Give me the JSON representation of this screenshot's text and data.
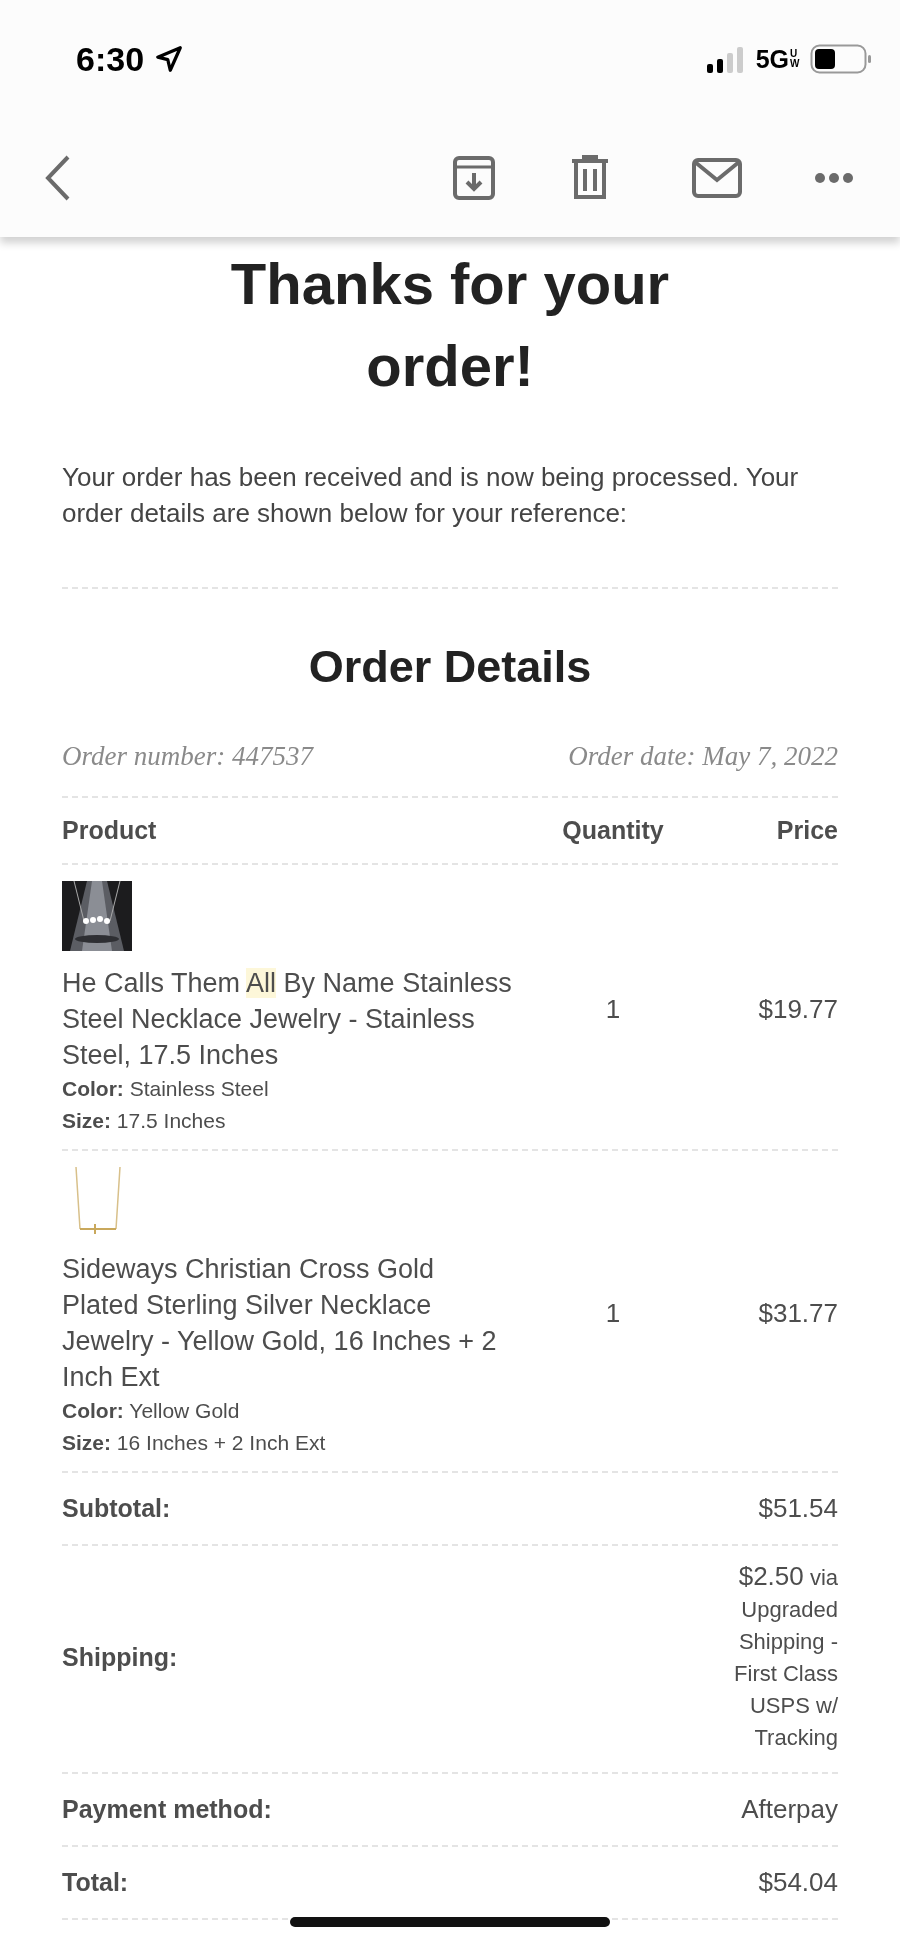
{
  "status_bar": {
    "time": "6:30",
    "network": "5G",
    "network_suffix": "UW"
  },
  "heading": [
    "Thanks for your",
    "order!"
  ],
  "intro": "Your order has been received and is now being processed. Your order details are shown below for your reference:",
  "section_title": "Order Details",
  "order_number": "Order number: 447537",
  "order_date": "Order date: May 7, 2022",
  "table": {
    "columns": [
      "Product",
      "Quantity",
      "Price"
    ],
    "rows": [
      {
        "name_before": "He Calls Them ",
        "name_highlight": "All",
        "name_after": " By Name Stainless Steel Necklace Jewelry - Stainless Steel, 17.5 Inches",
        "attributes": [
          {
            "label": "Color:",
            "value": "Stainless Steel"
          },
          {
            "label": "Size:",
            "value": "17.5 Inches"
          }
        ],
        "quantity": "1",
        "price": "$19.77"
      },
      {
        "name_before": "Sideways Christian Cross Gold Plated Sterling Silver Necklace Jewelry - Yellow Gold, 16 Inches + 2 Inch Ext",
        "name_highlight": "",
        "name_after": "",
        "attributes": [
          {
            "label": "Color:",
            "value": "Yellow Gold"
          },
          {
            "label": "Size:",
            "value": "16 Inches + 2 Inch Ext"
          }
        ],
        "quantity": "1",
        "price": "$31.77"
      }
    ]
  },
  "totals": [
    {
      "label": "Subtotal:",
      "value": "$51.54"
    },
    {
      "label": "Shipping:",
      "value": "$2.50",
      "note": "via Upgraded Shipping - First Class USPS w/ Tracking"
    },
    {
      "label": "Payment method:",
      "value": "Afterpay"
    },
    {
      "label": "Total:",
      "value": "$54.04"
    }
  ]
}
